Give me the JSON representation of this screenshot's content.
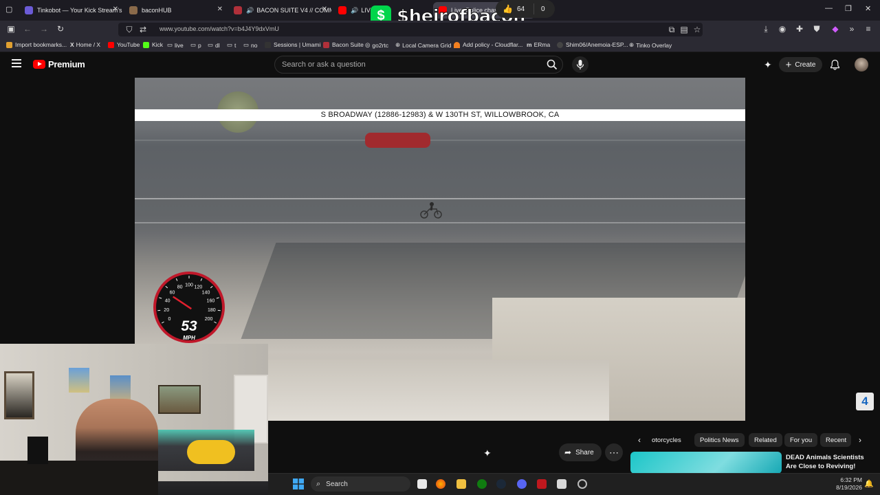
{
  "tabs": [
    {
      "title": "Tinkobot — Your Kick Stream's Inte",
      "fav_color": "#6b5bd6",
      "active": false
    },
    {
      "title": "baconHUB",
      "fav_color": "#8a6a4a",
      "active": false
    },
    {
      "title": "BACON SUITE V4 // COMM",
      "fav_color": "#b0303a",
      "active": false
    },
    {
      "title": "LIVE: P",
      "fav_color": "#ff0000",
      "active": false
    },
    {
      "title": "Live: Police chase allegedly",
      "fav_color": "#ff0000",
      "active": true
    }
  ],
  "new_tab_label": "+",
  "toolbar": {
    "url": "www.youtube.com/watch?v=b4J4Y9dxVmU"
  },
  "bookmarks": [
    {
      "label": "Import bookmarks...",
      "color": "#e0a030"
    },
    {
      "label": "Home / X",
      "color": "#ffffff"
    },
    {
      "label": "YouTube",
      "color": "#ff0000"
    },
    {
      "label": "Kick",
      "color": "#53fc18"
    },
    {
      "label": "live",
      "color": "#aaaaaa"
    },
    {
      "label": "p",
      "color": "#aaaaaa"
    },
    {
      "label": "dl",
      "color": "#aaaaaa"
    },
    {
      "label": "t",
      "color": "#aaaaaa"
    },
    {
      "label": "no",
      "color": "#aaaaaa"
    },
    {
      "label": "Sessions | Umami",
      "color": "#333333"
    },
    {
      "label": "Bacon Suite",
      "color": "#b0303a"
    },
    {
      "label": "go2rtc",
      "color": "#dddddd"
    },
    {
      "label": "Local Camera Grid",
      "color": "#cccccc"
    },
    {
      "label": "Add policy - Cloudflar...",
      "color": "#f38020"
    },
    {
      "label": "ERma",
      "color": "#dddddd"
    },
    {
      "label": "Shim06/Anemoia-ESP...",
      "color": "#444444"
    },
    {
      "label": "Tinko Overlay",
      "color": "#cccccc"
    }
  ],
  "youtube": {
    "brand": "Premium",
    "search_placeholder": "Search or ask a question",
    "create_label": "Create"
  },
  "video": {
    "location_banner": "S BROADWAY (12886-12983) & W 130TH ST, WILLOWBROOK, CA",
    "station_logo": "4"
  },
  "speedometer": {
    "speed": "53",
    "unit": "MPH",
    "ticks": [
      "0",
      "20",
      "40",
      "60",
      "80",
      "100",
      "120",
      "140",
      "160",
      "180",
      "200"
    ],
    "max": 200
  },
  "overlay": {
    "cashapp_symbol": "$",
    "cashtag": "$heirofbacon"
  },
  "actions": {
    "like_count": "64",
    "dislike_count": "0",
    "share_label": "Share",
    "more_label": "⋯"
  },
  "chips": [
    "otorcycles",
    "Politics News",
    "Related",
    "For you",
    "Recent"
  ],
  "related": {
    "title": "DEAD Animals Scientists Are Close to Reviving!"
  },
  "taskbar": {
    "search_label": "Search",
    "time": "6:32 PM",
    "date": "8/19/2026"
  },
  "colors": {
    "yt_red": "#ff0000",
    "speedo_red": "#c0182a",
    "banner_bg": "#ffffff"
  }
}
